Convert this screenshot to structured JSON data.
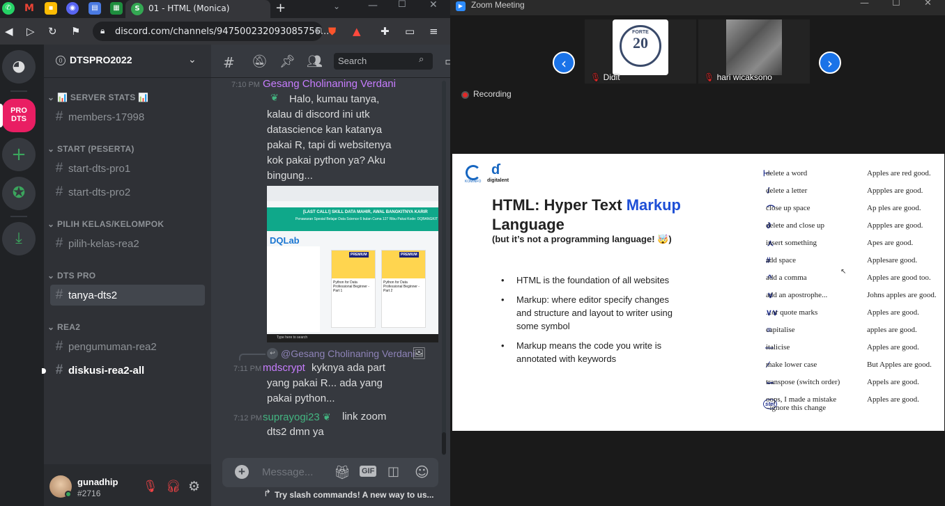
{
  "browser": {
    "active_tab_title": "01 - HTML (Monica)",
    "new_tab": "+",
    "url": "discord.com/channels/947500232093085756...",
    "favicons": [
      "whatsapp-icon",
      "gmail-icon",
      "keep-icon",
      "discord-icon",
      "chrome-tab-icon",
      "classroom-icon",
      "monica-icon"
    ]
  },
  "discord": {
    "server_name": "DTSPRO2022",
    "server_badge": "0",
    "guilds": {
      "pro_dts": "PRO DTS"
    },
    "categories": {
      "stats": "SERVER STATS",
      "start": "START (PESERTA)",
      "pilih": "PILIH KELAS/KELOMPOK",
      "dtspro": "DTS PRO",
      "rea2": "REA2"
    },
    "channels": {
      "members": "members-17998",
      "start1": "start-dts-pro1",
      "start2": "start-dts-pro2",
      "pilih": "pilih-kelas-rea2",
      "tanya": "tanya-dts2",
      "pengumuman": "pengumuman-rea2",
      "diskusi": "diskusi-rea2-all"
    },
    "user": {
      "name": "gunadhip",
      "tag": "#2716"
    },
    "search_placeholder": "Search",
    "messages": [
      {
        "time": "7:10 PM",
        "author": "Gesang Cholinaning Verdani",
        "author_color": "#c77dff",
        "text": "Halo, kumau tanya, kalau di discord ini utk datascience kan katanya pakai R, tapi di websitenya kok pakai python ya? Aku bingung..."
      },
      {
        "reply_to": "@Gesang Cholinaning Verdani"
      },
      {
        "time": "7:11 PM",
        "author": "mdscrypt",
        "author_color": "#c77dff",
        "text": "kyknya ada part yang pakai R... ada yang pakai python..."
      },
      {
        "time": "7:12 PM",
        "author": "suprayogi23",
        "author_color": "#43b581",
        "text": "link zoom dts2 dmn ya"
      }
    ],
    "embed": {
      "banner": "[LAST CALL!] SKILL DATA MAHIR, AWAL BANGKITNYA KARIR",
      "subline": "Penawaran Spesial Belajar Data Science 6 bulan Cuma 127 Ribu Pakai Kode: DQBANGKIT",
      "logo": "DQLab",
      "card1_title": "Python for Data Professional Beginner - Part 1",
      "card2_title": "Python for Data Professional Beginner - Part 2",
      "premium": "PREMIUM",
      "taskbar_search": "Type here to search"
    },
    "composer": {
      "placeholder": "Message...",
      "gif": "GIF"
    },
    "tip": "Try slash commands! A new way to us..."
  },
  "zoom": {
    "title": "Zoom Meeting",
    "recording": "Recording",
    "participants": [
      {
        "name": "Didit"
      },
      {
        "name": "hari wicaksono"
      }
    ],
    "tile1_logo_text": "20",
    "tile1_logo_top": "FORTE"
  },
  "slide": {
    "logos": {
      "kominfo": "KOMINFO",
      "digitalent": "digitalent"
    },
    "title_part1": "HTML: Hyper Text ",
    "title_highlight": "Markup",
    "title_part2": "Language",
    "subtitle": "(but it’s not a programming language! 🤯)",
    "bullets": [
      "HTML is the foundation of all websites",
      "Markup: where editor specify changes and structure and layout to writer using some symbol",
      "Markup means the code you write is annotated with keywords"
    ],
    "proofreading": [
      {
        "action": "delete a word",
        "example": "Apples are red good."
      },
      {
        "action": "delete a letter",
        "example": "Appples are good."
      },
      {
        "action": "close up space",
        "example": "Ap ples are good."
      },
      {
        "action": "delete and close up",
        "example": "Appples are good."
      },
      {
        "action": "insert something",
        "example": "Apes are good."
      },
      {
        "action": "add space",
        "example": "Applesare good."
      },
      {
        "action": "add a comma",
        "example": "Apples are good too."
      },
      {
        "action": "add an apostrophe...",
        "example": "Johns apples are good."
      },
      {
        "action": "...or quote marks",
        "example": "Apples are good."
      },
      {
        "action": "capitalise",
        "example": "apples are good."
      },
      {
        "action": "italicise",
        "example": "Apples are good."
      },
      {
        "action": "make lower case",
        "example": "But Apples are good."
      },
      {
        "action": "transpose (switch order)",
        "example": "Appels are good."
      },
      {
        "action": "oops, I made a mistake\n–ignore this change",
        "example": "Apples are good."
      }
    ],
    "marks": [
      "⊢",
      "/",
      "⌒",
      "∂",
      "⋏",
      "#",
      "^",
      "∨",
      "∨∨",
      "≡",
      "—",
      "⁄",
      "∽",
      "stet"
    ]
  },
  "colors": {
    "discord_blurple": "#5865f2",
    "pro_dts": "#e91e63",
    "zoom_blue": "#1a73e8",
    "markup_blue": "#1e4fd6"
  }
}
